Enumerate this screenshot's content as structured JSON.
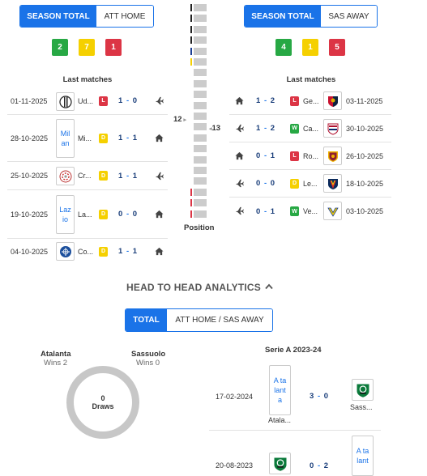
{
  "home": {
    "tabs": [
      {
        "label": "SEASON TOTAL",
        "active": true
      },
      {
        "label": "ATT HOME",
        "active": false
      }
    ],
    "record": {
      "wins": "2",
      "draws": "7",
      "losses": "1"
    },
    "last_matches_title": "Last matches",
    "matches": [
      {
        "date": "01-11-2025",
        "logo": "udinese-logo",
        "team": "Ud...",
        "result": "L",
        "score_home": "1",
        "score_away": "0",
        "venue": "away-plane-icon"
      },
      {
        "date": "28-10-2025",
        "logo_text": "Mil an",
        "team": "Mi...",
        "result": "D",
        "score_home": "1",
        "score_away": "1",
        "venue": "home-house-icon"
      },
      {
        "date": "25-10-2025",
        "logo": "cremonese-logo",
        "team": "Cr...",
        "result": "D",
        "score_home": "1",
        "score_away": "1",
        "venue": "away-plane-icon"
      },
      {
        "date": "19-10-2025",
        "logo_text": "Laz io",
        "team": "La...",
        "result": "D",
        "score_home": "0",
        "score_away": "0",
        "venue": "home-house-icon"
      },
      {
        "date": "04-10-2025",
        "logo": "como-logo",
        "team": "Co...",
        "result": "D",
        "score_home": "1",
        "score_away": "1",
        "venue": "home-house-icon"
      }
    ]
  },
  "away": {
    "tabs": [
      {
        "label": "SEASON TOTAL",
        "active": true
      },
      {
        "label": "SAS AWAY",
        "active": false
      }
    ],
    "record": {
      "wins": "4",
      "draws": "1",
      "losses": "5"
    },
    "last_matches_title": "Last matches",
    "matches": [
      {
        "date": "03-11-2025",
        "logo": "genoa-logo",
        "team": "Ge...",
        "result": "L",
        "score_home": "1",
        "score_away": "2",
        "venue": "home-house-icon"
      },
      {
        "date": "30-10-2025",
        "logo": "cagliari-logo",
        "team": "Ca...",
        "result": "W",
        "score_home": "1",
        "score_away": "2",
        "venue": "away-plane-icon"
      },
      {
        "date": "26-10-2025",
        "logo": "roma-logo",
        "team": "Ro...",
        "result": "L",
        "score_home": "0",
        "score_away": "1",
        "venue": "home-house-icon"
      },
      {
        "date": "18-10-2025",
        "logo": "lecce-logo",
        "team": "Le...",
        "result": "D",
        "score_home": "0",
        "score_away": "0",
        "venue": "away-plane-icon"
      },
      {
        "date": "03-10-2025",
        "logo": "verona-logo",
        "team": "Ve...",
        "result": "W",
        "score_home": "0",
        "score_away": "1",
        "venue": "away-plane-icon"
      }
    ]
  },
  "position": {
    "home_rank": "12",
    "away_rank": "13",
    "label": "Position",
    "total_teams": 20
  },
  "h2h": {
    "title": "HEAD TO HEAD ANALYTICS",
    "tabs": [
      {
        "label": "TOTAL",
        "active": true
      },
      {
        "label": "ATT HOME / SAS AWAY",
        "active": false
      }
    ],
    "home_name": "Atalanta",
    "home_wins": "Wins 2",
    "away_name": "Sassuolo",
    "away_wins": "Wins 0",
    "draws_count": "0",
    "draws_label": "Draws",
    "season_title": "Serie A 2023-24",
    "matches": [
      {
        "date": "17-02-2024",
        "home_logo_text": "A ta lant a",
        "home_team": "Atala...",
        "score_home": "3",
        "score_away": "0",
        "away_team": "Sass..."
      },
      {
        "date": "20-08-2023",
        "score_home": "0",
        "score_away": "2",
        "away_logo_text": "A ta lant"
      }
    ]
  },
  "colors": {
    "accent": "#1a73e8",
    "win": "#27a844",
    "draw": "#f5d000",
    "loss": "#dc3545"
  }
}
